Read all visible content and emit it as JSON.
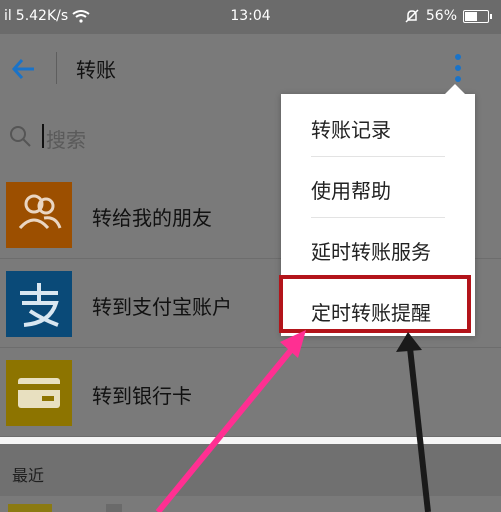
{
  "status_bar": {
    "signal": "il",
    "speed": "5.42K/s",
    "time": "13:04",
    "battery": "56%",
    "battery_level": 0.56
  },
  "app_bar": {
    "title": "转账"
  },
  "search": {
    "placeholder": "搜索"
  },
  "list": {
    "items": [
      {
        "label": "转给我的朋友",
        "icon": "friends-icon",
        "color": "#9c4f00"
      },
      {
        "label": "转到支付宝账户",
        "icon": "alipay-icon",
        "color": "#0a4a78"
      },
      {
        "label": "转到银行卡",
        "icon": "bank-card-icon",
        "color": "#8d7400"
      }
    ]
  },
  "recent": {
    "label": "最近"
  },
  "menu": {
    "items": [
      {
        "label": "转账记录"
      },
      {
        "label": "使用帮助"
      },
      {
        "label": "延时转账服务"
      },
      {
        "label": "定时转账提醒"
      }
    ]
  },
  "colors": {
    "accent": "#1a73c8",
    "highlight_border": "#b3141a",
    "pink_arrow": "#ff2f92",
    "dark_arrow": "#1a1a1a"
  }
}
